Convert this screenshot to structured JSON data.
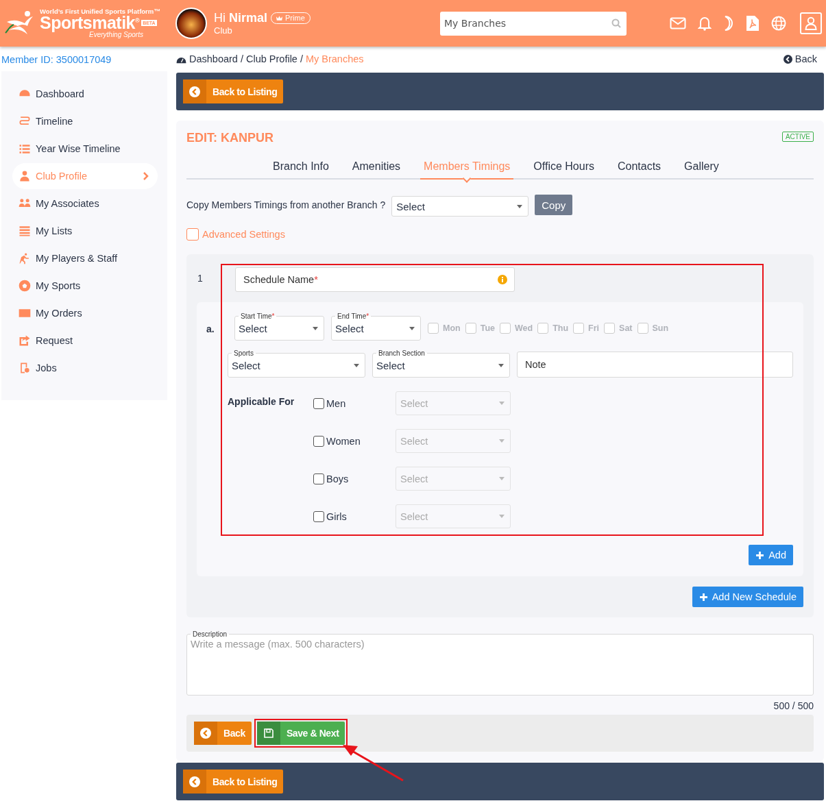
{
  "header": {
    "logo": {
      "tagline": "World’s First Unified Sports Platform™",
      "name": "Sportsmatik$^{®}$",
      "badge": "BETA",
      "subtitle": "Everything Sports"
    },
    "greeting": "Hi **Nirmal**",
    "plan_badge": "Prime",
    "role": "Club",
    "search": {
      "value": "My Branches"
    }
  },
  "member_id": "Member ID: 3500017049",
  "breadcrumb": [
    {
      "label": "Dashboard",
      "selected": false
    },
    {
      "label": "Club Profile",
      "separator": "/",
      "selected": false
    },
    {
      "label": "My Branches",
      "separator": "/",
      "selected": true
    }
  ],
  "back_link": "Back",
  "sidebar": {
    "items": [
      {
        "label": "Dashboard",
        "selected": false
      },
      {
        "label": "Timeline",
        "selected": false
      },
      {
        "label": "Year Wise Timeline",
        "selected": false
      },
      {
        "label": "Club Profile",
        "selected": true
      },
      {
        "label": "My Associates",
        "selected": false
      },
      {
        "label": "My Lists",
        "selected": false
      },
      {
        "label": "My Players & Staff",
        "selected": false
      },
      {
        "label": "My Sports",
        "selected": false
      },
      {
        "label": "My Orders",
        "selected": false
      },
      {
        "label": "Request",
        "selected": false
      },
      {
        "label": "Jobs",
        "selected": false
      }
    ]
  },
  "top_bar": {
    "button": "Back to Listing"
  },
  "card": {
    "title": "EDIT: KANPUR",
    "status": "ACTIVE",
    "tabs": [
      {
        "label": "Branch Info",
        "selected": false
      },
      {
        "label": "Amenities",
        "selected": false
      },
      {
        "label": "Members Timings",
        "selected": true
      },
      {
        "label": "Office Hours",
        "selected": false
      },
      {
        "label": "Contacts",
        "selected": false
      },
      {
        "label": "Gallery",
        "selected": false
      }
    ],
    "copy": {
      "label": "Copy Members Timings from another Branch ?",
      "select": "Select",
      "button": "Copy"
    },
    "advanced": {
      "label": "Advanced Settings",
      "checked": false
    },
    "schedules": [
      {
        "number": "1",
        "highlighted": true,
        "name_field": {
          "placeholder": "Schedule Name",
          "mark": "*"
        },
        "slots": [
          {
            "letter": "a.",
            "start": {
              "label": "Start Time",
              "mark": "*",
              "value": "Select"
            },
            "end": {
              "label": "End Time",
              "mark": "*",
              "value": "Select"
            },
            "days": [
              {
                "label": "Mon",
                "checked": false,
                "disabled": true
              },
              {
                "label": "Tue",
                "checked": false,
                "disabled": true
              },
              {
                "label": "Wed",
                "checked": false,
                "disabled": true
              },
              {
                "label": "Thu",
                "checked": false,
                "disabled": true
              },
              {
                "label": "Fri",
                "checked": false,
                "disabled": true
              },
              {
                "label": "Sat",
                "checked": false,
                "disabled": true
              },
              {
                "label": "Sun",
                "checked": false,
                "disabled": true
              }
            ],
            "sports": {
              "label": "Sports",
              "value": "Select"
            },
            "section": {
              "label": "Branch Section",
              "value": "Select"
            },
            "note": {
              "placeholder": "Note"
            },
            "applicable": {
              "label": "Applicable For",
              "options": [
                {
                  "label": "Men",
                  "checked": false,
                  "select": "Select",
                  "disabled": true
                },
                {
                  "label": "Women",
                  "checked": false,
                  "select": "Select",
                  "disabled": true
                },
                {
                  "label": "Boys",
                  "checked": false,
                  "select": "Select",
                  "disabled": true
                },
                {
                  "label": "Girls",
                  "checked": false,
                  "select": "Select",
                  "disabled": true
                }
              ]
            }
          }
        ],
        "add_button": "Add"
      }
    ],
    "add_schedule": "Add New Schedule",
    "description": {
      "label": "Description",
      "placeholder": "Write a message (max. 500 characters)",
      "counter": "500 / 500"
    },
    "actions": [
      {
        "kind": "back",
        "label": "Back",
        "highlighted": false
      },
      {
        "kind": "save",
        "label": "Save & Next",
        "highlighted": true
      }
    ]
  },
  "bottom_bar": {
    "button": "Back to Listing"
  }
}
